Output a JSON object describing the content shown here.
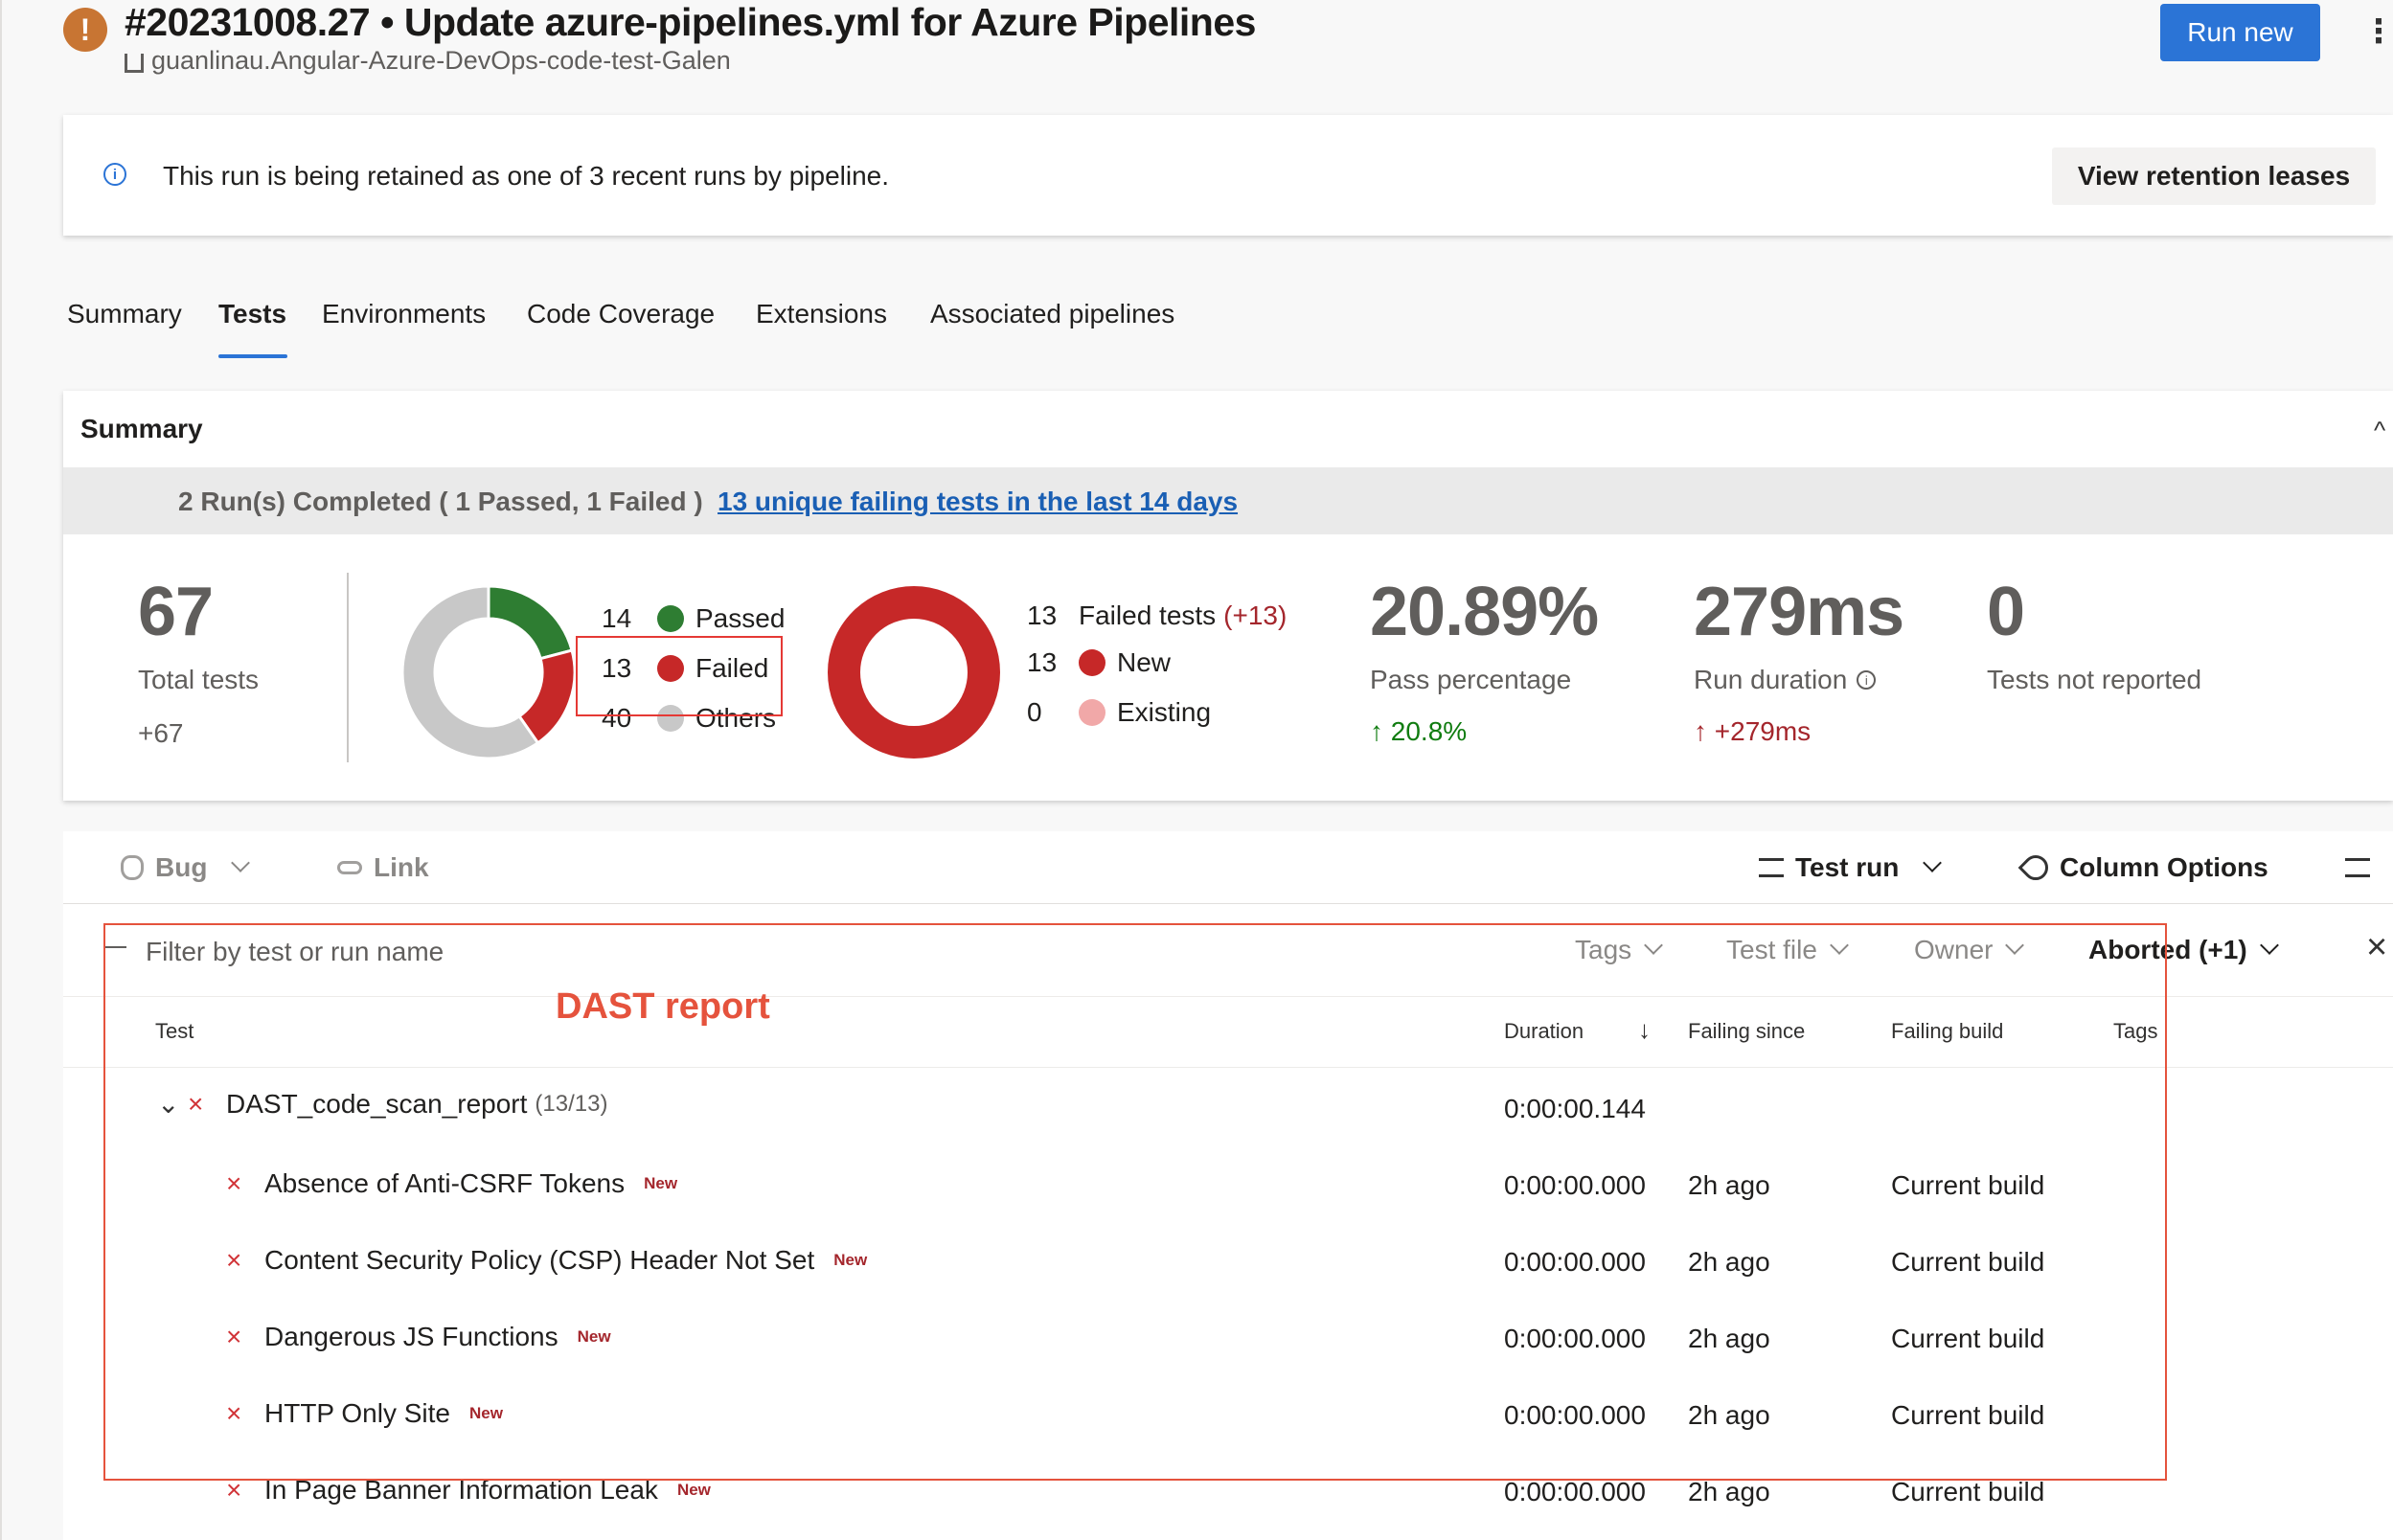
{
  "header": {
    "run_title": "#20231008.27 • Update azure-pipelines.yml for Azure Pipelines",
    "repo": "guanlinau.Angular-Azure-DevOps-code-test-Galen",
    "run_new_label": "Run new",
    "more_label": "⋮",
    "warning_glyph": "!"
  },
  "info_banner": {
    "icon": "i",
    "text": "This run is being retained as one of 3 recent runs by pipeline.",
    "button_label": "View retention leases"
  },
  "tabs": [
    {
      "label": "Summary"
    },
    {
      "label": "Tests"
    },
    {
      "label": "Environments"
    },
    {
      "label": "Code Coverage"
    },
    {
      "label": "Extensions"
    },
    {
      "label": "Associated pipelines"
    }
  ],
  "summary": {
    "title": "Summary",
    "caret": "^",
    "runs_completed": "2 Run(s) Completed ( 1 Passed, 1 Failed )",
    "failing_link": "13 unique failing tests in the last 14 days",
    "total_tests": "67",
    "total_tests_label": "Total tests",
    "total_tests_delta": "+67",
    "outcome_legend": [
      {
        "count": "14",
        "label": "Passed",
        "color": "#2e7d32"
      },
      {
        "count": "13",
        "label": "Failed",
        "color": "#c62828"
      },
      {
        "count": "40",
        "label": "Others",
        "color": "#c8c8c8"
      }
    ],
    "failed_tests_count": "13",
    "failed_tests_label": "Failed tests",
    "failed_tests_delta": "(+13)",
    "failed_legend": [
      {
        "count": "13",
        "label": "New",
        "color": "#c62828"
      },
      {
        "count": "0",
        "label": "Existing",
        "color": "#f1a8a8"
      }
    ],
    "pass_percentage": "20.89%",
    "pass_percentage_label": "Pass percentage",
    "pass_percentage_delta": "20.8%",
    "run_duration": "279ms",
    "run_duration_label": "Run duration",
    "run_duration_delta": "+279ms",
    "not_reported": "0",
    "not_reported_label": "Tests not reported",
    "up_arrow": "↑",
    "info_glyph": "i"
  },
  "toolbar": {
    "bug_label": "Bug",
    "link_label": "Link",
    "test_run_label": "Test run",
    "column_options_label": "Column Options"
  },
  "filters": {
    "placeholder": "Filter by test or run name",
    "tags": "Tags",
    "test_file": "Test file",
    "owner": "Owner",
    "aborted": "Aborted (+1)",
    "close": "×"
  },
  "annotation": {
    "label": "DAST report"
  },
  "table": {
    "columns": {
      "test": "Test",
      "duration": "Duration",
      "sort": "↓",
      "failing_since": "Failing since",
      "failing_build": "Failing build",
      "tags": "Tags"
    },
    "group": {
      "name": "DAST_code_scan_report",
      "count": "(13/13)",
      "duration": "0:00:00.144",
      "expand": "⌄",
      "status": "×"
    },
    "rows": [
      {
        "name": "Absence of Anti-CSRF Tokens",
        "tag": "New",
        "duration": "0:00:00.000",
        "failing_since": "2h ago",
        "failing_build": "Current build",
        "status": "×"
      },
      {
        "name": "Content Security Policy (CSP) Header Not Set",
        "tag": "New",
        "duration": "0:00:00.000",
        "failing_since": "2h ago",
        "failing_build": "Current build",
        "status": "×"
      },
      {
        "name": "Dangerous JS Functions",
        "tag": "New",
        "duration": "0:00:00.000",
        "failing_since": "2h ago",
        "failing_build": "Current build",
        "status": "×"
      },
      {
        "name": "HTTP Only Site",
        "tag": "New",
        "duration": "0:00:00.000",
        "failing_since": "2h ago",
        "failing_build": "Current build",
        "status": "×"
      },
      {
        "name": "In Page Banner Information Leak",
        "tag": "New",
        "duration": "0:00:00.000",
        "failing_since": "2h ago",
        "failing_build": "Current build",
        "status": "×"
      }
    ]
  },
  "chart_data": [
    {
      "type": "pie",
      "categories": [
        "Passed",
        "Failed",
        "Others"
      ],
      "values": [
        14,
        13,
        40
      ],
      "colors": [
        "#2e7d32",
        "#c62828",
        "#c8c8c8"
      ]
    },
    {
      "type": "pie",
      "categories": [
        "New",
        "Existing"
      ],
      "values": [
        13,
        0
      ],
      "colors": [
        "#c62828",
        "#f1a8a8"
      ]
    }
  ]
}
